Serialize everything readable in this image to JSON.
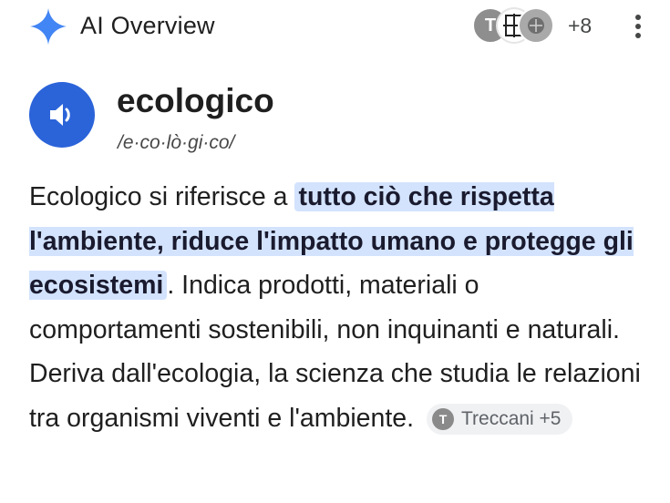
{
  "header": {
    "title": "AI Overview",
    "avatar_letters": [
      "T",
      "",
      ""
    ],
    "more_sources_count": "+8"
  },
  "definition": {
    "word": "ecologico",
    "phonetic": "/e·co·lò·gi·co/"
  },
  "body": {
    "intro": "Ecologico si riferisce a ",
    "highlight_line1": "tutto ciò che rispetta",
    "highlight_line2": "l'ambiente, riduce l'impatto umano e",
    "highlight_line3": "protegge gli ecosistemi",
    "rest": ". Indica prodotti, materiali o comportamenti sostenibili, non inquinanti e naturali. Deriva dall'ecologia, la scienza che studia le relazioni tra organismi viventi e l'ambiente."
  },
  "source_chip": {
    "icon_letter": "T",
    "label": "Treccani +5"
  },
  "colors": {
    "accent_blue": "#2b63d9",
    "highlight_bg": "#d3e3fd",
    "sparkle": "#4285f4"
  }
}
